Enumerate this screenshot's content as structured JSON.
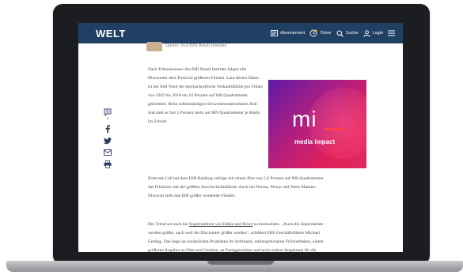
{
  "colors": {
    "navbar": "#1f3f63",
    "laptop": "#1c1d20",
    "ad_from": "#5e1aa5",
    "ad_to": "#e0295e"
  },
  "header": {
    "logo": "WELT",
    "items": [
      {
        "label": "Abonnement",
        "icon": "newspaper-icon"
      },
      {
        "label": "Ticker",
        "icon": "ticker-icon"
      },
      {
        "label": "Suche",
        "icon": "search-icon"
      },
      {
        "label": "Login",
        "icon": "user-icon"
      }
    ],
    "menu_icon": "hamburger-menu-icon"
  },
  "article": {
    "author_line": "Quelle: ISA/EHI Retail Institute",
    "para1": "Nach Erkenntnissen des EHI Retail Institute folgen alle Discounter dem Trend zu größeren Filialen. Laut diesen Daten ist bei Aldi Nord die durchschnittliche Verkaufsfläche pro Filiale von 2010 bis 2018 um 10 Prozent auf 848 Quadratmeter gekletttert. Beim selbstständigen Schwesterunternehmen Aldi Süd sind es fast 5 Prozent mehr auf 869 Quadratmeter je Markt im Schnitt.",
    "para2": "Erstrvale Lidl hat dem EHI-Ranking zufolge mit einem Plus von 5,6 Prozent auf 898 Quadratmeter das Filialnetz mit der größten Durchschnittsfläche. Auch bei Norma, Penny und Netto Marken-Discount sieht das EHI größer werdende Filialen.",
    "para3_before": "Der Trend sei auch bei ",
    "para3_link": "Supermärkten wie Edeka und Rewe",
    "para3_after": " zu beobachten. „Auch die Supermärkte werden größer, auch weil die Discounter größer werden\", schildert EHI-Geschäftsführer Michael Gerling. Das liege an zusätzlichen Produkten im Sortiment, umfangreicheren Frischetheken, einem größeren Angebot an Obst und Gemüse, an Fertiggerichten und nicht zuletzt Angeboten für die Mittagspause wie Sandwich und Salat."
  },
  "ad": {
    "mark": "mi",
    "name": "media impact"
  },
  "share": {
    "comment_count": "0",
    "icons": [
      "comment-icon",
      "facebook-icon",
      "twitter-icon",
      "email-icon",
      "print-icon"
    ]
  }
}
